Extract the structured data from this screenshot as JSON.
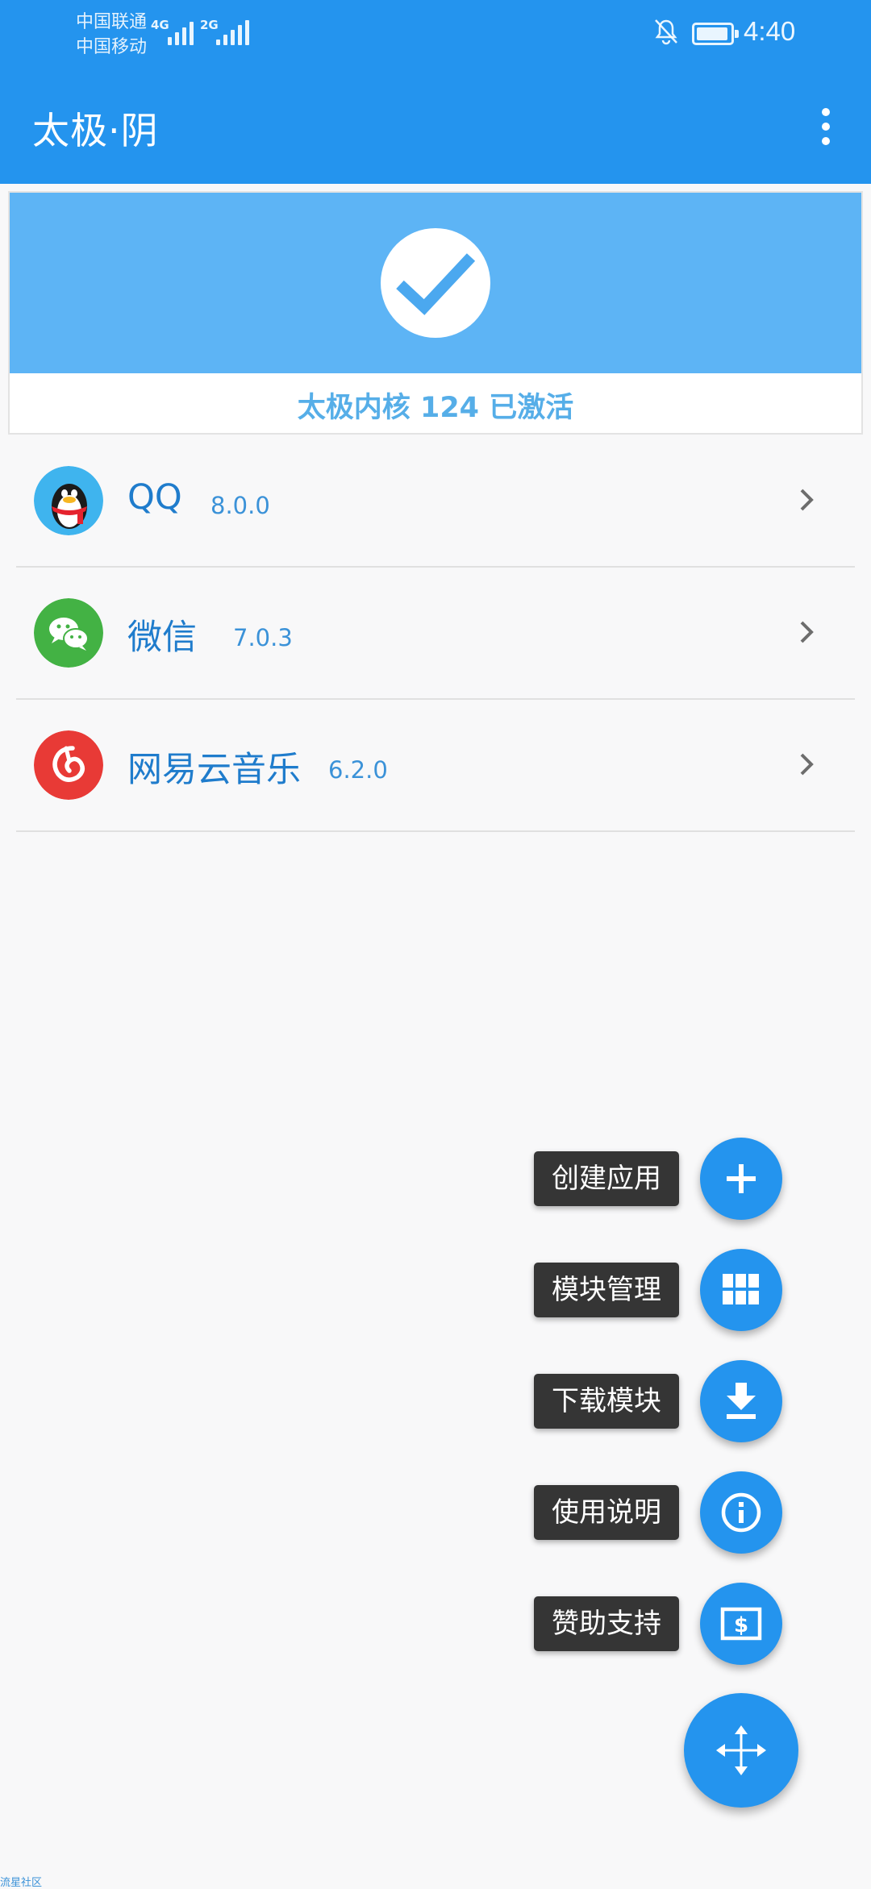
{
  "status_bar": {
    "carrier_1": "中国联通",
    "carrier_2": "中国移动",
    "network_1": "4G",
    "network_2": "2G",
    "time": "4:40",
    "icons": [
      "signal-icon",
      "bell-off-icon",
      "battery-icon"
    ]
  },
  "app_bar": {
    "title": "太极·阴",
    "menu_icon": "more-vert-icon"
  },
  "status_card": {
    "icon": "check-icon",
    "text": "太极内核 124 已激活",
    "colors": {
      "banner": "#5db4f5",
      "text": "#56aee8"
    }
  },
  "apps": [
    {
      "name": "QQ",
      "version": "8.0.0",
      "icon": "qq-penguin-icon"
    },
    {
      "name": "微信",
      "version": "7.0.3",
      "icon": "wechat-icon"
    },
    {
      "name": "网易云音乐",
      "version": "6.2.0",
      "icon": "netease-music-icon"
    }
  ],
  "speed_dial": [
    {
      "label": "创建应用",
      "icon": "plus-icon"
    },
    {
      "label": "模块管理",
      "icon": "grid-icon"
    },
    {
      "label": "下载模块",
      "icon": "download-icon"
    },
    {
      "label": "使用说明",
      "icon": "info-icon"
    },
    {
      "label": "赞助支持",
      "icon": "money-icon"
    }
  ],
  "main_fab": {
    "icon": "move-arrows-icon"
  },
  "watermark": "流星社区",
  "colors": {
    "primary": "#2494ee",
    "label_bg": "#353535",
    "app_text": "#1f7ccc"
  }
}
